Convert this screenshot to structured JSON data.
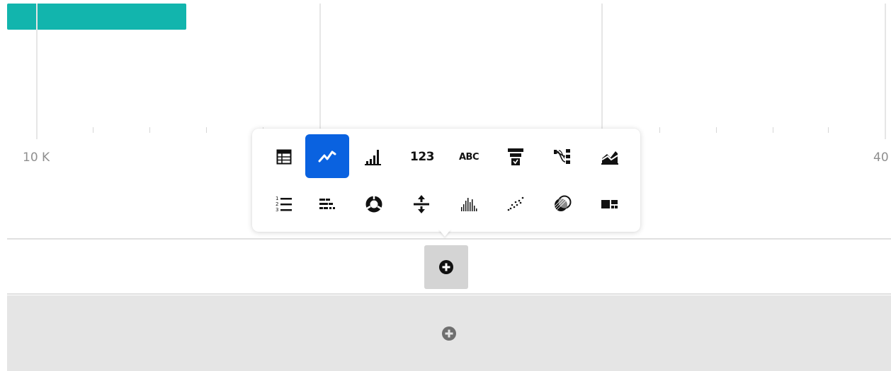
{
  "colors": {
    "bar": "#12b5ad",
    "selected": "#0a62e0",
    "add_icon_dark": "#111111",
    "add_icon_muted": "#6f6f6f"
  },
  "chart": {
    "axis_labels": [
      "10 K",
      "40"
    ]
  },
  "viz_picker": {
    "selected": "line-chart",
    "row1": [
      {
        "icon": "table-icon"
      },
      {
        "icon": "line-chart-icon"
      },
      {
        "icon": "bar-chart-icon"
      },
      {
        "icon": "number-icon",
        "label": "123"
      },
      {
        "icon": "text-icon",
        "label": "ABC"
      },
      {
        "icon": "funnel-icon"
      },
      {
        "icon": "sankey-icon"
      },
      {
        "icon": "area-chart-icon"
      }
    ],
    "row2": [
      {
        "icon": "ordered-list-icon"
      },
      {
        "icon": "progress-bars-icon"
      },
      {
        "icon": "donut-chart-icon"
      },
      {
        "icon": "split-icon"
      },
      {
        "icon": "histogram-icon"
      },
      {
        "icon": "scatter-plot-icon"
      },
      {
        "icon": "venn-icon"
      },
      {
        "icon": "treemap-icon"
      }
    ]
  },
  "add_button": {
    "icon": "plus-circle-icon"
  },
  "add_row": {
    "icon": "plus-circle-icon"
  }
}
